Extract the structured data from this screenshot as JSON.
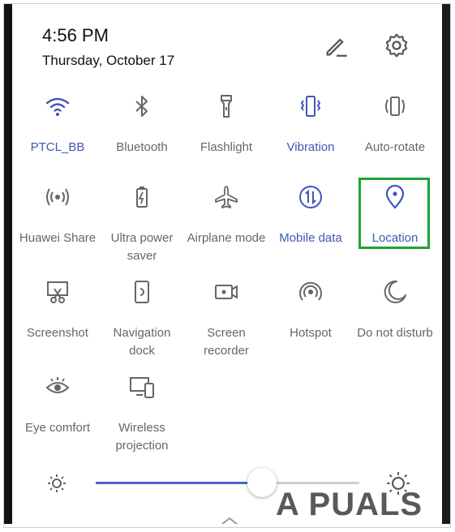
{
  "header": {
    "time": "4:56 PM",
    "date": "Thursday, October 17",
    "edit_icon": "pencil-icon",
    "settings_icon": "gear-icon"
  },
  "tiles": [
    {
      "label": "PTCL_BB",
      "icon": "wifi-icon",
      "active": true
    },
    {
      "label": "Bluetooth",
      "icon": "bluetooth-icon",
      "active": false
    },
    {
      "label": "Flashlight",
      "icon": "flashlight-icon",
      "active": false
    },
    {
      "label": "Vibration",
      "icon": "vibration-icon",
      "active": true
    },
    {
      "label": "Auto-rotate",
      "icon": "auto-rotate-icon",
      "active": false
    },
    {
      "label": "Huawei Share",
      "icon": "share-icon",
      "active": false
    },
    {
      "label": "Ultra power\nsaver",
      "icon": "battery-saver-icon",
      "active": false
    },
    {
      "label": "Airplane mode",
      "icon": "airplane-icon",
      "active": false
    },
    {
      "label": "Mobile data",
      "icon": "mobile-data-icon",
      "active": true
    },
    {
      "label": "Location",
      "icon": "location-pin-icon",
      "active": true
    },
    {
      "label": "Screenshot",
      "icon": "screenshot-icon",
      "active": false
    },
    {
      "label": "Navigation\ndock",
      "icon": "navigation-dock-icon",
      "active": false
    },
    {
      "label": "Screen\nrecorder",
      "icon": "screen-recorder-icon",
      "active": false
    },
    {
      "label": "Hotspot",
      "icon": "hotspot-icon",
      "active": false
    },
    {
      "label": "Do not disturb",
      "icon": "moon-icon",
      "active": false
    },
    {
      "label": "Eye comfort",
      "icon": "eye-icon",
      "active": false
    },
    {
      "label": "Wireless\nprojection",
      "icon": "projection-icon",
      "active": false
    }
  ],
  "brightness": {
    "level": 0.66
  },
  "watermark": {
    "text": "A PUALS"
  },
  "colors": {
    "active": "#3d57b7",
    "inactive": "#666666",
    "highlight": "#1ea337"
  }
}
